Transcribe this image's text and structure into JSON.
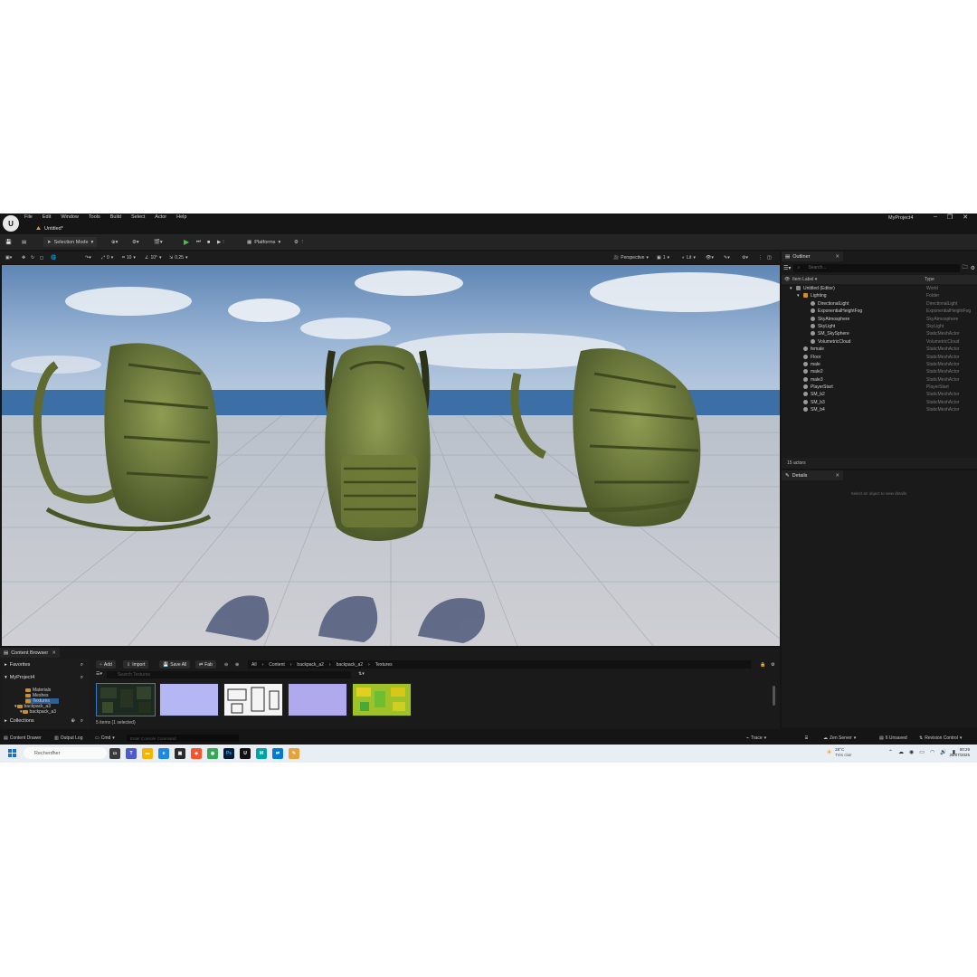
{
  "app": {
    "logo_text": "U",
    "menu": [
      "File",
      "Edit",
      "Window",
      "Tools",
      "Build",
      "Select",
      "Actor",
      "Help"
    ],
    "project_name": "MyProject4",
    "window_controls": [
      "–",
      "❐",
      "✕"
    ],
    "document_tab": "Untitled*"
  },
  "toolbar": {
    "mode": "Selection Mode",
    "platforms": "Platforms"
  },
  "viewport_toolbar": {
    "grid_snap": "10",
    "rotation_snap": "10°",
    "scale_snap": "0.25",
    "camera_speed": "0",
    "perspective": "Perspective",
    "lit": "Lit",
    "screen_count": "1"
  },
  "outliner": {
    "tab": "Outliner",
    "search_placeholder": "Search...",
    "col_label": "Item Label",
    "col_type": "Type",
    "rows": [
      {
        "label": "Untitled (Editor)",
        "type": "World",
        "indent": 0
      },
      {
        "label": "Lighting",
        "type": "Folder",
        "indent": 1
      },
      {
        "label": "DirectionalLight",
        "type": "DirectionalLight",
        "indent": 2
      },
      {
        "label": "ExponentialHeightFog",
        "type": "ExponentialHeightFog",
        "indent": 2
      },
      {
        "label": "SkyAtmosphere",
        "type": "SkyAtmosphere",
        "indent": 2
      },
      {
        "label": "SkyLight",
        "type": "SkyLight",
        "indent": 2
      },
      {
        "label": "SM_SkySphere",
        "type": "StaticMeshActor",
        "indent": 2
      },
      {
        "label": "VolumetricCloud",
        "type": "VolumetricCloud",
        "indent": 2
      },
      {
        "label": "female",
        "type": "StaticMeshActor",
        "indent": 1
      },
      {
        "label": "Floor",
        "type": "StaticMeshActor",
        "indent": 1
      },
      {
        "label": "male",
        "type": "StaticMeshActor",
        "indent": 1
      },
      {
        "label": "male2",
        "type": "StaticMeshActor",
        "indent": 1
      },
      {
        "label": "male3",
        "type": "StaticMeshActor",
        "indent": 1
      },
      {
        "label": "PlayerStart",
        "type": "PlayerStart",
        "indent": 1
      },
      {
        "label": "SM_b2",
        "type": "StaticMeshActor",
        "indent": 1
      },
      {
        "label": "SM_b3",
        "type": "StaticMeshActor",
        "indent": 1
      },
      {
        "label": "SM_b4",
        "type": "StaticMeshActor",
        "indent": 1
      }
    ],
    "actor_count": "15 actors"
  },
  "details": {
    "tab": "Details",
    "hint": "Select an object to view details."
  },
  "content_browser": {
    "tab": "Content Browser",
    "favorites": "Favorites",
    "project": "MyProject4",
    "tree": [
      "Materials",
      "Meshes",
      "Textures",
      "backpack_a3",
      "backpack_a3"
    ],
    "collections": "Collections",
    "add": "Add",
    "import": "Import",
    "save_all": "Save All",
    "fab": "Fab",
    "breadcrumb": [
      "All",
      "Content",
      "backpack_a2",
      "backpack_a2",
      "Textures"
    ],
    "search_placeholder": "Search Textures",
    "item_count": "5 items (1 selected)",
    "thumbnails": [
      "diffuse-texture",
      "normal-texture",
      "ao-texture",
      "normal-texture-2",
      "orm-texture"
    ]
  },
  "statusbar": {
    "content_drawer": "Content Drawer",
    "output_log": "Output Log",
    "cmd": "Cmd",
    "console_placeholder": "Enter Console Command",
    "trace": "Trace",
    "zen_server": "Zen Server",
    "unsaved": "6 Unsaved",
    "revision_control": "Revision Control"
  },
  "taskbar": {
    "search": "Rechercher",
    "temperature": "28°C",
    "weather": "Très clair",
    "time": "00:29",
    "date": "26/07/2025"
  }
}
